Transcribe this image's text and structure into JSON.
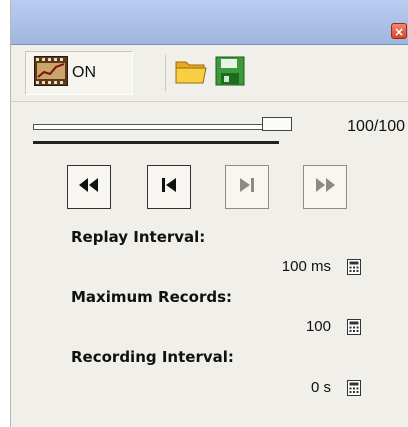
{
  "window": {
    "close_glyph": "×"
  },
  "toolbar": {
    "record_toggle_label": "ON",
    "record_icon": "film-chart-icon",
    "open_icon": "folder-icon",
    "save_icon": "floppy-disk-icon"
  },
  "replay": {
    "position_text": "100/100",
    "position": 100,
    "total": 100
  },
  "controls": {
    "rewind_icon": "rewind-icon",
    "prev_icon": "step-back-icon",
    "next_icon": "step-forward-icon",
    "ff_icon": "fast-forward-icon"
  },
  "settings": {
    "replay_interval_label": "Replay Interval:",
    "replay_interval_value": "100 ms",
    "max_records_label": "Maximum Records:",
    "max_records_value": "100",
    "recording_interval_label": "Recording Interval:",
    "recording_interval_value": "0 s",
    "edit_icon": "calculator-icon"
  },
  "colors": {
    "titlebar": "#9fb6e0",
    "close_button": "#d4462a",
    "panel_background": "#f0efe9",
    "save_icon_green": "#3c9a3c",
    "folder_yellow": "#f2c12e"
  }
}
